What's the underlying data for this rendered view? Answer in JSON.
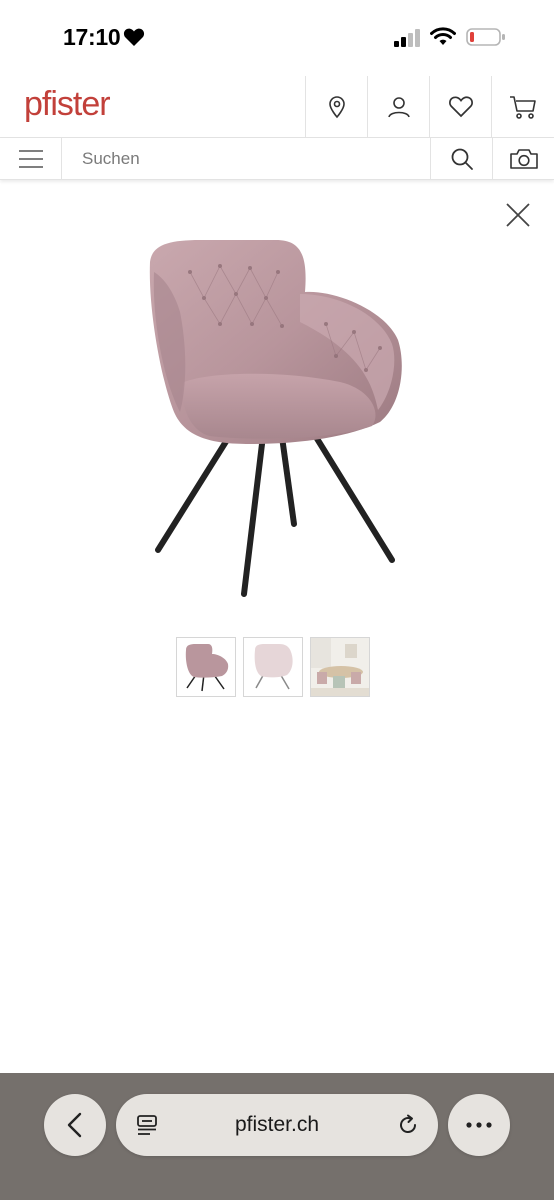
{
  "status_bar": {
    "time": "17:10",
    "icons": [
      "heart-icon",
      "cellular-signal-icon",
      "wifi-icon",
      "battery-low-icon"
    ]
  },
  "header": {
    "logo": "pfister",
    "brand_color": "#c2403a",
    "icons": [
      "location-pin-icon",
      "account-icon",
      "wishlist-heart-icon",
      "cart-icon"
    ]
  },
  "search": {
    "placeholder": "Suchen",
    "icons": [
      "hamburger-menu-icon",
      "search-icon",
      "camera-icon"
    ]
  },
  "gallery": {
    "close_icon": "close-icon",
    "main_image": "pink velvet armchair with black metal legs",
    "thumbnails": [
      {
        "subject": "pink velvet armchair",
        "selected": true
      },
      {
        "subject": "light pink velvet armchair",
        "selected": false
      },
      {
        "subject": "dining room scene",
        "selected": false
      }
    ]
  },
  "browser": {
    "url": "pfister.ch",
    "icons": [
      "back-chevron-icon",
      "reader-mode-icon",
      "reload-icon",
      "more-options-icon"
    ],
    "bar_color": "#75706c"
  }
}
